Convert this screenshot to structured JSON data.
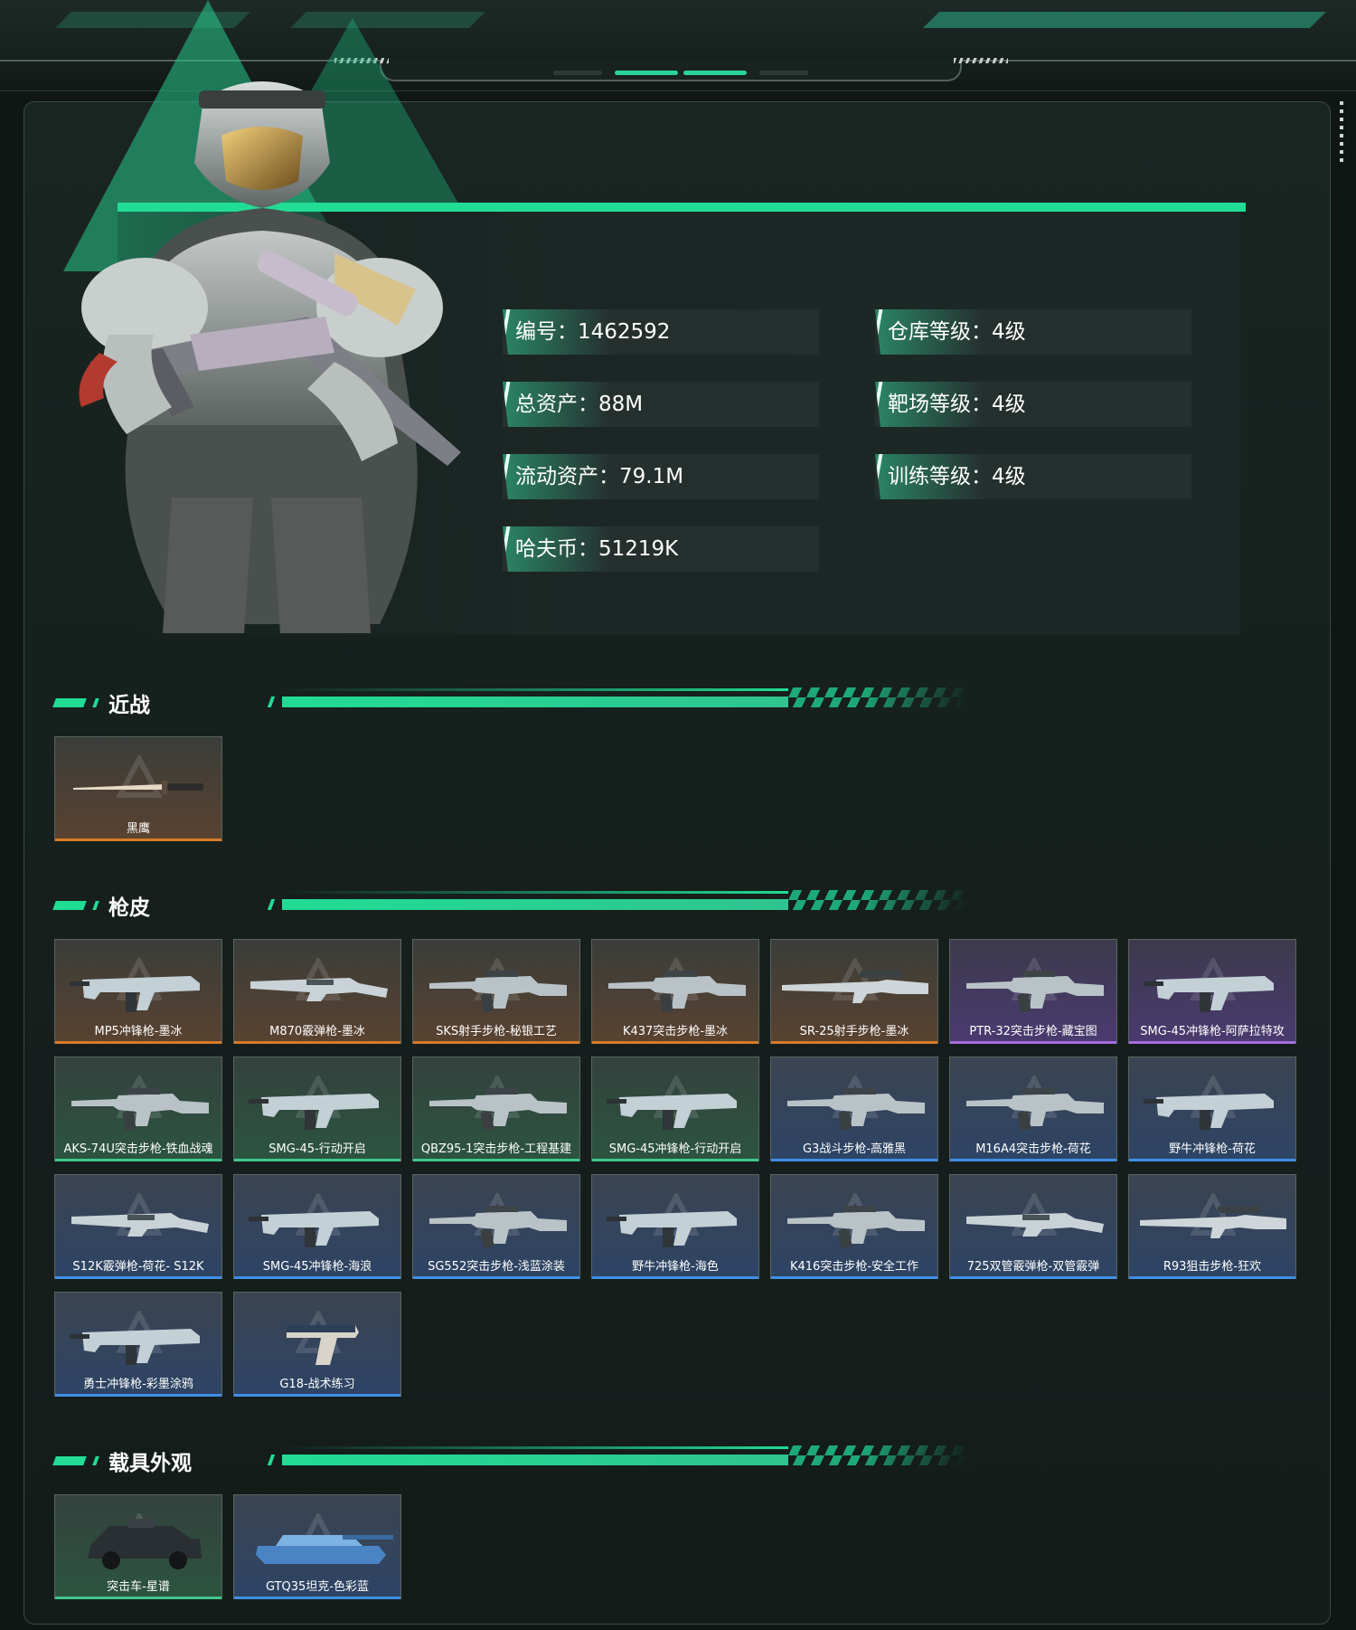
{
  "stats": {
    "id": "编号：1462592",
    "total_assets": "总资产：88M",
    "liquid_assets": "流动资产：79.1M",
    "haf_coins": "哈夫币：51219K",
    "warehouse_level": "仓库等级：4级",
    "range_level": "靶场等级：4级",
    "training_level": "训练等级：4级"
  },
  "sections": {
    "melee": {
      "title": "近战",
      "items": [
        {
          "label": "黑鹰",
          "rarity": "orange",
          "icon": "knife-icon"
        }
      ]
    },
    "gun_skins": {
      "title": "枪皮",
      "items": [
        {
          "label": "MP5冲锋枪-墨冰",
          "rarity": "orange",
          "icon": "smg-icon"
        },
        {
          "label": "M870霰弹枪-墨冰",
          "rarity": "orange",
          "icon": "shotgun-icon"
        },
        {
          "label": "SKS射手步枪-秘银工艺",
          "rarity": "orange",
          "icon": "rifle-icon"
        },
        {
          "label": "K437突击步枪-墨冰",
          "rarity": "orange",
          "icon": "rifle-icon"
        },
        {
          "label": "SR-25射手步枪-墨冰",
          "rarity": "orange",
          "icon": "sniper-icon"
        },
        {
          "label": "PTR-32突击步枪-藏宝图",
          "rarity": "purple",
          "icon": "rifle-icon"
        },
        {
          "label": "SMG-45冲锋枪-阿萨拉特攻",
          "rarity": "purple",
          "icon": "smg-icon"
        },
        {
          "label": "AKS-74U突击步枪-铁血战魂",
          "rarity": "green",
          "icon": "rifle-icon"
        },
        {
          "label": "SMG-45-行动开启",
          "rarity": "green",
          "icon": "smg-icon"
        },
        {
          "label": "QBZ95-1突击步枪-工程基建",
          "rarity": "green",
          "icon": "rifle-icon"
        },
        {
          "label": "SMG-45冲锋枪-行动开启",
          "rarity": "green",
          "icon": "smg-icon"
        },
        {
          "label": "G3战斗步枪-高雅黑",
          "rarity": "blue",
          "icon": "rifle-icon"
        },
        {
          "label": "M16A4突击步枪-荷花",
          "rarity": "blue",
          "icon": "rifle-icon"
        },
        {
          "label": "野牛冲锋枪-荷花",
          "rarity": "blue",
          "icon": "smg-icon"
        },
        {
          "label": "S12K霰弹枪-荷花- S12K",
          "rarity": "blue",
          "icon": "shotgun-icon"
        },
        {
          "label": "SMG-45冲锋枪-海浪",
          "rarity": "blue",
          "icon": "smg-icon"
        },
        {
          "label": "SG552突击步枪-浅蓝涂装",
          "rarity": "blue",
          "icon": "rifle-icon"
        },
        {
          "label": "野牛冲锋枪-海色",
          "rarity": "blue",
          "icon": "smg-icon"
        },
        {
          "label": "K416突击步枪-安全工作",
          "rarity": "blue",
          "icon": "rifle-icon"
        },
        {
          "label": "725双管霰弹枪-双管霰弹",
          "rarity": "blue",
          "icon": "shotgun-icon"
        },
        {
          "label": "R93狙击步枪-狂欢",
          "rarity": "blue",
          "icon": "sniper-icon"
        },
        {
          "label": "勇士冲锋枪-彩墨涂鸦",
          "rarity": "blue",
          "icon": "smg-icon"
        },
        {
          "label": "G18-战术练习",
          "rarity": "blue",
          "icon": "pistol-icon"
        }
      ]
    },
    "vehicles": {
      "title": "载具外观",
      "items": [
        {
          "label": "突击车-星谱",
          "rarity": "green",
          "icon": "armored-car-icon"
        },
        {
          "label": "GTQ35坦克-色彩蓝",
          "rarity": "blue",
          "icon": "tank-icon"
        }
      ]
    }
  },
  "colors": {
    "accent_green": "#21dc95",
    "rarity_orange": "#d97a2a",
    "rarity_purple": "#a56ee0",
    "rarity_green": "#3fc98b",
    "rarity_blue": "#3f8fe6"
  }
}
